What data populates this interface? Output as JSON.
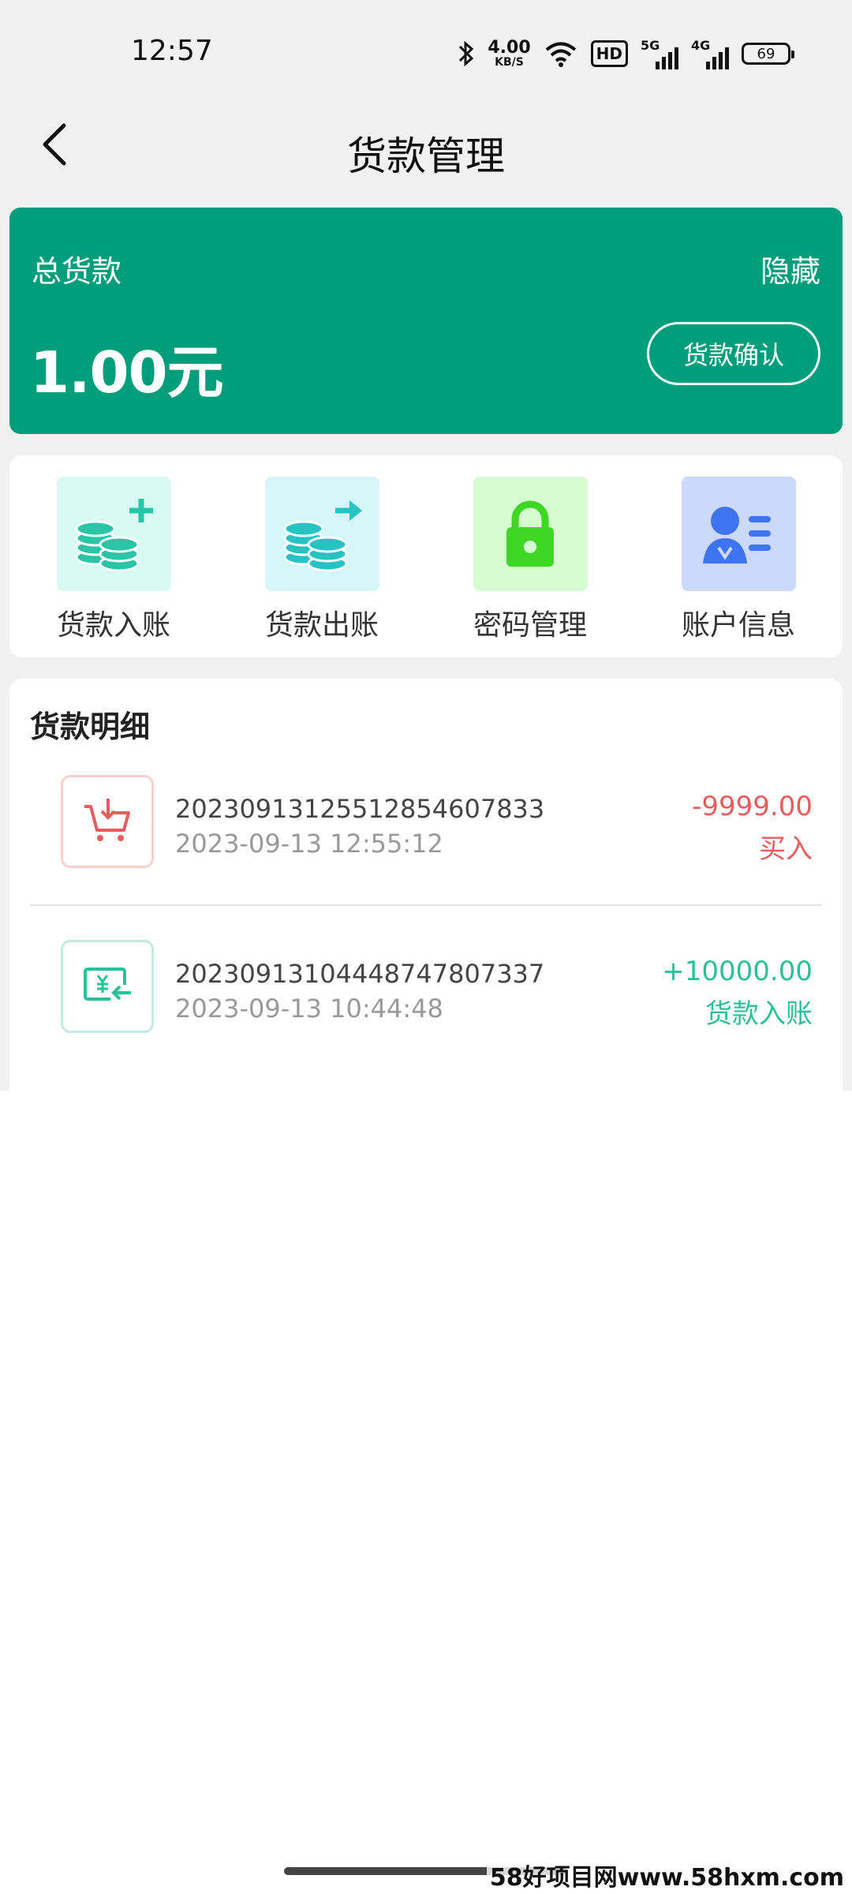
{
  "status_bar": {
    "time": "12:57",
    "net_speed": "4.00",
    "net_speed_unit": "KB/S",
    "hd_label": "HD",
    "sim1_label": "5G",
    "sim2_label": "4G",
    "battery": "69"
  },
  "header": {
    "title": "货款管理"
  },
  "balance": {
    "label": "总货款",
    "hide_label": "隐藏",
    "amount": "1.00元",
    "confirm_label": "货款确认"
  },
  "actions": [
    {
      "label": "货款入账",
      "icon": "coins-plus-icon",
      "bg": "#d7faf3"
    },
    {
      "label": "货款出账",
      "icon": "coins-arrow-out-icon",
      "bg": "#d5f7f7"
    },
    {
      "label": "密码管理",
      "icon": "lock-icon",
      "bg": "#d7fcd3"
    },
    {
      "label": "账户信息",
      "icon": "account-card-icon",
      "bg": "#ccd9fb"
    }
  ],
  "detail": {
    "title": "货款明细",
    "rows": [
      {
        "id": "20230913125512854607833",
        "time": "2023-09-13 12:55:12",
        "amount": "-9999.00",
        "type": "买入",
        "icon": "cart-download-icon",
        "color": "#e85c5c"
      },
      {
        "id": "20230913104448747807337",
        "time": "2023-09-13 10:44:48",
        "amount": "+10000.00",
        "type": "货款入账",
        "icon": "yuan-transfer-in-icon",
        "color": "#2bbf9a"
      }
    ]
  },
  "watermark": "58好项目网www.58hxm.com",
  "colors": {
    "brand_green": "#009e7a",
    "outflow_red": "#e85c5c",
    "inflow_teal": "#2bbf9a"
  }
}
